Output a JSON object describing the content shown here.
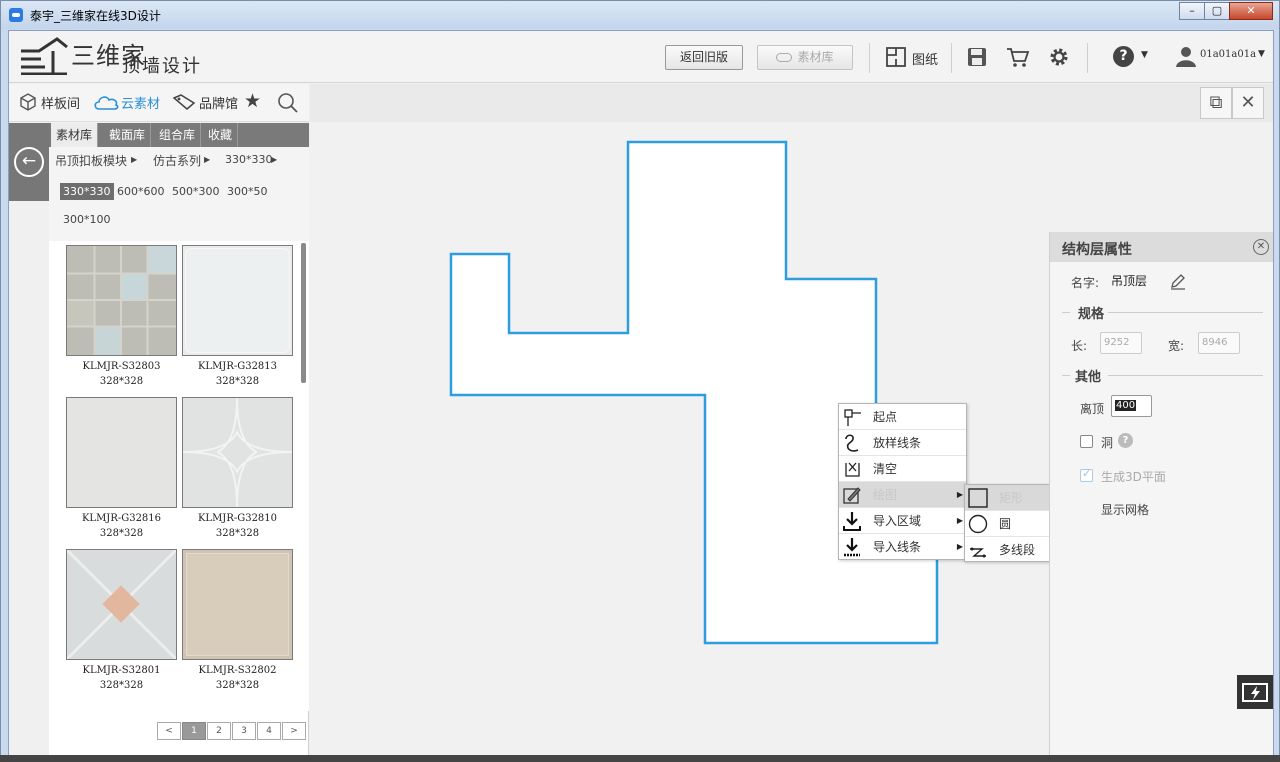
{
  "window": {
    "title": "泰宇_三维家在线3D设计",
    "minimize": "–",
    "maximize": "▢",
    "close": "✕"
  },
  "header": {
    "logo_text": "三维家",
    "subtitle": "顶墙设计",
    "back_old_label": "返回旧版",
    "material_lib_label": "素材库",
    "drawings_label": "图纸",
    "help_glyph": "?",
    "username": "01a01a01a"
  },
  "left_tabs": [
    {
      "label": "样板间",
      "active": false
    },
    {
      "label": "云素材",
      "active": true
    },
    {
      "label": "品牌馆",
      "active": false
    }
  ],
  "sub_tabs": [
    "素材库",
    "截面库",
    "组合库",
    "收藏"
  ],
  "breadcrumbs": [
    "吊顶扣板模块",
    "仿古系列",
    "330*330"
  ],
  "sizes": [
    "330*330",
    "600*600",
    "500*300",
    "300*50",
    "300*100"
  ],
  "tiles": [
    {
      "name": "KLMJR-S32803",
      "size": "328*328"
    },
    {
      "name": "KLMJR-G32813",
      "size": "328*328"
    },
    {
      "name": "KLMJR-G32816",
      "size": "328*328"
    },
    {
      "name": "KLMJR-G32810",
      "size": "328*328"
    },
    {
      "name": "KLMJR-S32801",
      "size": "328*328"
    },
    {
      "name": "KLMJR-S32802",
      "size": "328*328"
    }
  ],
  "pager": {
    "prev": "<",
    "pages": [
      "1",
      "2",
      "3",
      "4"
    ],
    "next": ">",
    "current": "1"
  },
  "context_menu": [
    {
      "label": "起点",
      "icon": "start-point-icon",
      "submenu": false
    },
    {
      "label": "放样线条",
      "icon": "loft-line-icon",
      "submenu": false
    },
    {
      "label": "清空",
      "icon": "clear-icon",
      "submenu": false
    },
    {
      "label": "绘图",
      "icon": "draw-icon",
      "submenu": true
    },
    {
      "label": "导入区域",
      "icon": "import-area-icon",
      "submenu": true
    },
    {
      "label": "导入线条",
      "icon": "import-line-icon",
      "submenu": true
    }
  ],
  "submenu": [
    {
      "label": "矩形",
      "icon": "rectangle-icon"
    },
    {
      "label": "圆",
      "icon": "circle-icon"
    },
    {
      "label": "多线段",
      "icon": "polyline-icon"
    }
  ],
  "properties": {
    "title": "结构层属性",
    "name_label": "名字:",
    "name_value": "吊顶层",
    "spec_section": "规格",
    "length_label": "长:",
    "length_value": "9252",
    "width_label": "宽:",
    "width_value": "8946",
    "other_section": "其他",
    "offset_label": "离顶",
    "offset_value": "400",
    "hole_label": "洞",
    "hole_checked": false,
    "gen3d_label": "生成3D平面",
    "gen3d_checked": true,
    "grid_label": "显示网格"
  },
  "colors": {
    "accent": "#2a8fd8",
    "shape_stroke": "#2c9de0"
  }
}
